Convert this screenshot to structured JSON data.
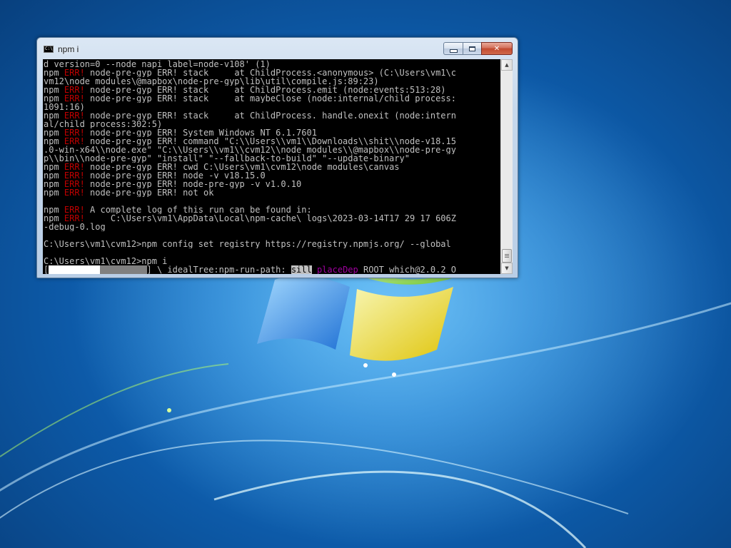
{
  "window": {
    "title": "npm i",
    "icon": "cmd-console-icon",
    "controls": {
      "minimize": "minimize-icon",
      "maximize": "maximize-icon",
      "close": "close-icon"
    }
  },
  "console": {
    "lines": [
      [
        {
          "t": "d_version=0 --node_napi_label=node-v108' (1)"
        }
      ],
      [
        {
          "t": "npm "
        },
        {
          "t": "ERR!",
          "c": "err"
        },
        {
          "t": " node-pre-gyp ERR! stack     at ChildProcess.<anonymous> (C:\\Users\\vm1\\c"
        }
      ],
      [
        {
          "t": "vm12\\node_modules\\@mapbox\\node-pre-gyp\\lib\\util\\compile.js:89:23)"
        }
      ],
      [
        {
          "t": "npm "
        },
        {
          "t": "ERR!",
          "c": "err"
        },
        {
          "t": " node-pre-gyp ERR! stack     at ChildProcess.emit (node:events:513:28)"
        }
      ],
      [
        {
          "t": "npm "
        },
        {
          "t": "ERR!",
          "c": "err"
        },
        {
          "t": " node-pre-gyp ERR! stack     at maybeClose (node:internal/child_process:"
        }
      ],
      [
        {
          "t": "1091:16)"
        }
      ],
      [
        {
          "t": "npm "
        },
        {
          "t": "ERR!",
          "c": "err"
        },
        {
          "t": " node-pre-gyp ERR! stack     at ChildProcess._handle.onexit (node:intern"
        }
      ],
      [
        {
          "t": "al/child_process:302:5)"
        }
      ],
      [
        {
          "t": "npm "
        },
        {
          "t": "ERR!",
          "c": "err"
        },
        {
          "t": " node-pre-gyp ERR! System Windows_NT 6.1.7601"
        }
      ],
      [
        {
          "t": "npm "
        },
        {
          "t": "ERR!",
          "c": "err"
        },
        {
          "t": " node-pre-gyp ERR! command \"C:\\\\Users\\\\vm1\\\\Downloads\\\\shit\\\\node-v18.15"
        }
      ],
      [
        {
          "t": ".0-win-x64\\\\node.exe\" \"C:\\\\Users\\\\vm1\\\\cvm12\\\\node_modules\\\\@mapbox\\\\node-pre-gy"
        }
      ],
      [
        {
          "t": "p\\\\bin\\\\node-pre-gyp\" \"install\" \"--fallback-to-build\" \"--update-binary\""
        }
      ],
      [
        {
          "t": "npm "
        },
        {
          "t": "ERR!",
          "c": "err"
        },
        {
          "t": " node-pre-gyp ERR! cwd C:\\Users\\vm1\\cvm12\\node_modules\\canvas"
        }
      ],
      [
        {
          "t": "npm "
        },
        {
          "t": "ERR!",
          "c": "err"
        },
        {
          "t": " node-pre-gyp ERR! node -v v18.15.0"
        }
      ],
      [
        {
          "t": "npm "
        },
        {
          "t": "ERR!",
          "c": "err"
        },
        {
          "t": " node-pre-gyp ERR! node-pre-gyp -v v1.0.10"
        }
      ],
      [
        {
          "t": "npm "
        },
        {
          "t": "ERR!",
          "c": "err"
        },
        {
          "t": " node-pre-gyp ERR! not ok"
        }
      ],
      [
        {
          "t": ""
        }
      ],
      [
        {
          "t": "npm "
        },
        {
          "t": "ERR!",
          "c": "err"
        },
        {
          "t": " A complete log of this run can be found in:"
        }
      ],
      [
        {
          "t": "npm "
        },
        {
          "t": "ERR!",
          "c": "err"
        },
        {
          "t": "     C:\\Users\\vm1\\AppData\\Local\\npm-cache\\_logs\\2023-03-14T17_29_17_606Z"
        }
      ],
      [
        {
          "t": "-debug-0.log"
        }
      ],
      [
        {
          "t": ""
        }
      ],
      [
        {
          "t": "C:\\Users\\vm1\\cvm12>npm config set registry https://registry.npmjs.org/ --global"
        }
      ],
      [
        {
          "t": ""
        }
      ],
      [
        {
          "t": "C:\\Users\\vm1\\cvm12>npm i"
        }
      ],
      [
        {
          "t": "["
        },
        {
          "t": "          ",
          "c": "prog-done"
        },
        {
          "t": "         ",
          "c": "prog-part"
        },
        {
          "t": "] \\ idealTree:npm-run-path: "
        },
        {
          "t": "sill",
          "c": "sill"
        },
        {
          "t": " "
        },
        {
          "t": "placeDep",
          "c": "place"
        },
        {
          "t": " ROOT which@2.0.2 O"
        }
      ]
    ],
    "progress_fraction": 0.53
  },
  "scrollbar": {
    "up_arrow": "scroll-up-arrow-icon",
    "down_arrow": "scroll-down-arrow-icon"
  },
  "colors": {
    "console_bg": "#000000",
    "console_fg": "#c0c0c0",
    "error_red": "#c00000",
    "placedep_magenta": "#a000a0",
    "desktop_blue": "#1f7fd0"
  }
}
